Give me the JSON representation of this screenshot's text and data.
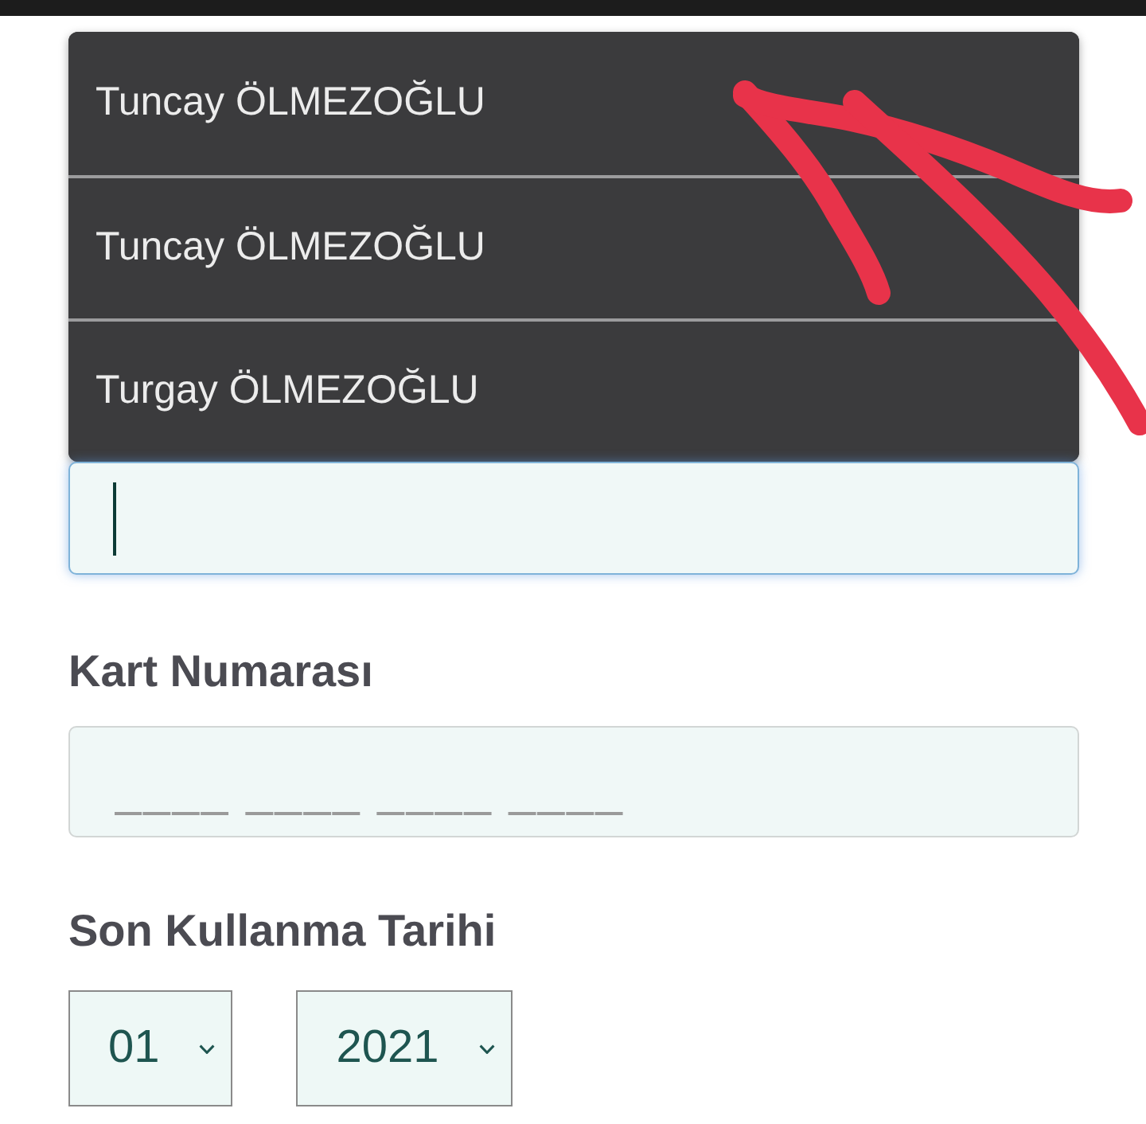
{
  "suggestions": [
    {
      "label": "Tuncay ÖLMEZOĞLU",
      "selected": false
    },
    {
      "label": "Tuncay ÖLMEZOĞLU",
      "selected": false
    },
    {
      "label": "Turgay ÖLMEZOĞLU",
      "selected": false
    }
  ],
  "name_field": {
    "focused": true
  },
  "card_number": {
    "label": "Kart Numarası",
    "placeholder": "____ ____ ____ ____"
  },
  "expiry": {
    "label": "Son Kullanma Tarihi",
    "selects": [
      {
        "value": "01"
      },
      {
        "value": "2021"
      }
    ]
  },
  "annotation": {
    "kind": "arrow"
  }
}
